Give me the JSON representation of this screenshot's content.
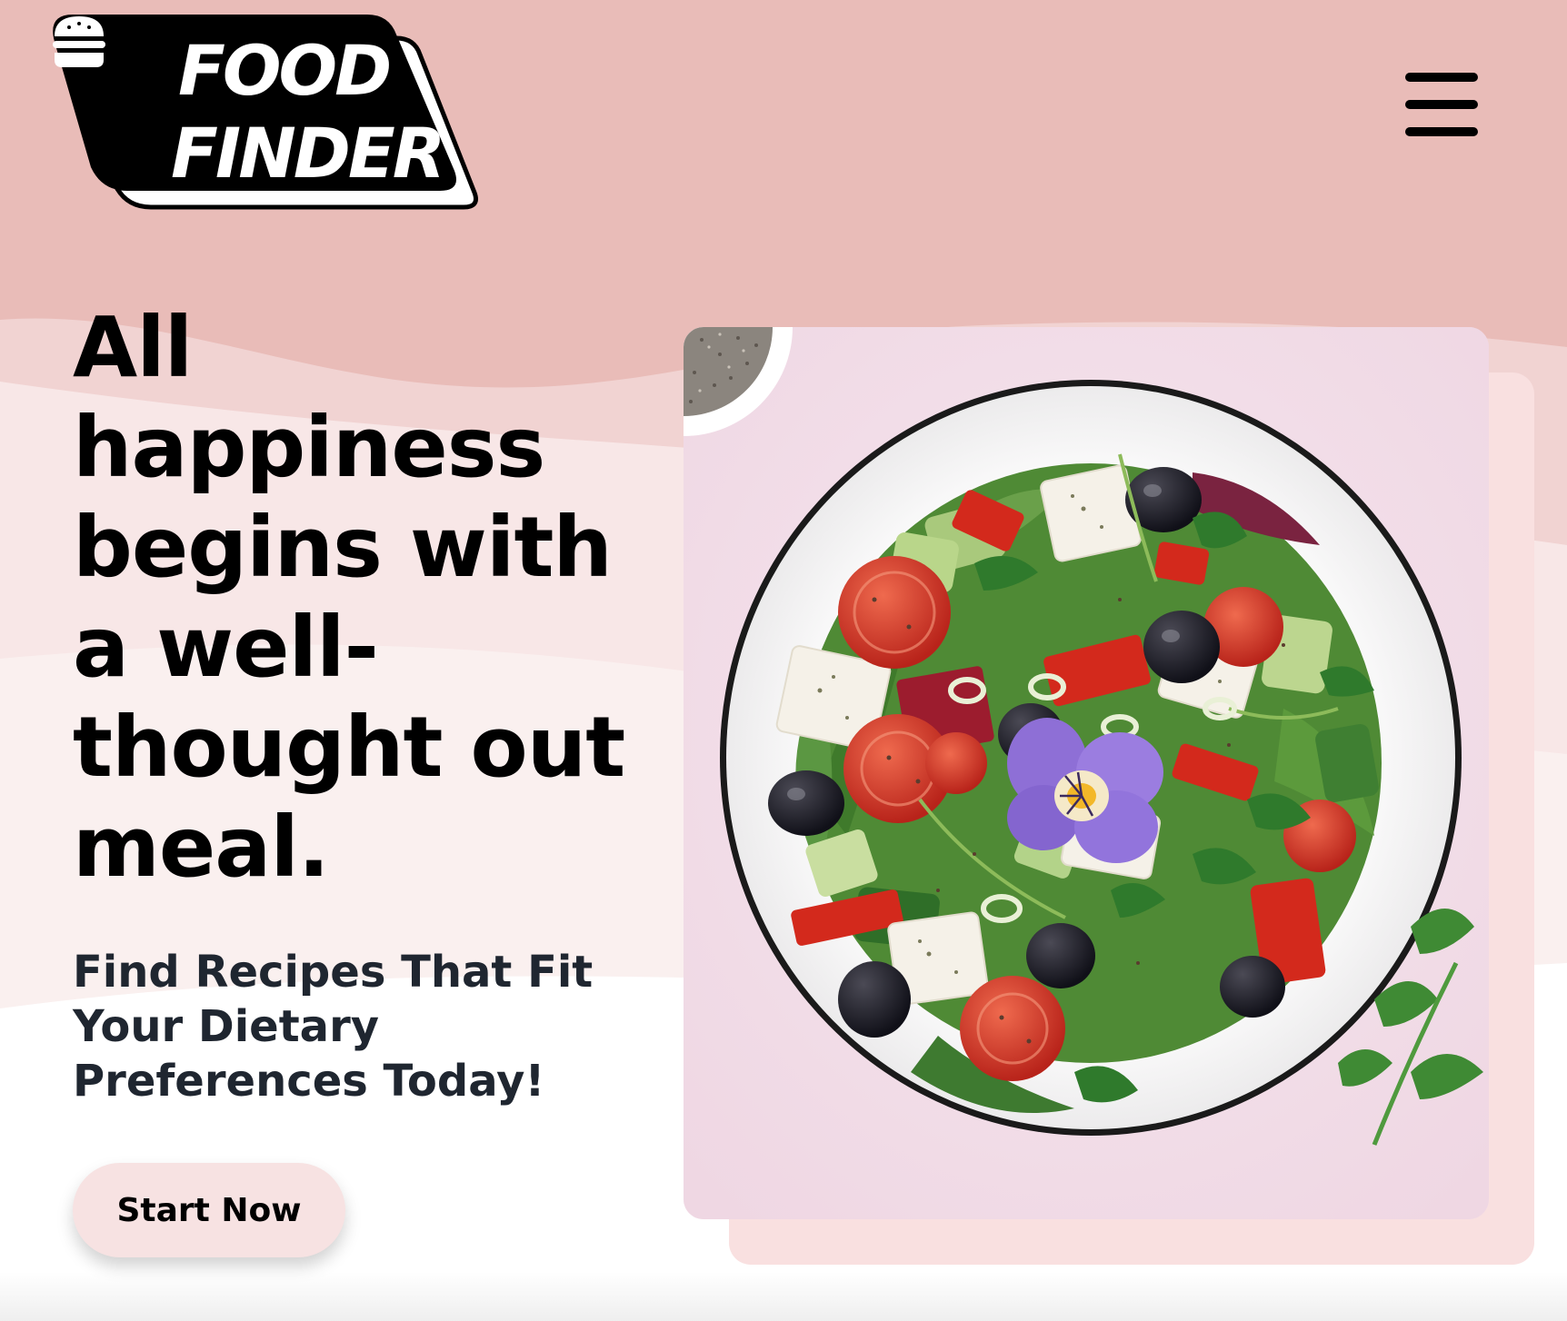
{
  "header": {
    "logo": {
      "line1": "FOOD",
      "line2": "FINDER",
      "icon": "burger-icon"
    },
    "menu_icon": "hamburger-menu-icon"
  },
  "hero": {
    "title_lines": [
      "All",
      "happiness",
      "begins with",
      "a well-",
      "thought out",
      "meal."
    ],
    "subtitle_lines": [
      "Find Recipes That Fit",
      "Your Dietary",
      "Preferences Today!"
    ],
    "cta_label": "Start Now"
  },
  "image": {
    "alt": "salad-bowl-image"
  },
  "colors": {
    "band_top": "#e9bcb8",
    "band_middle": "#f1d2d1",
    "band_light": "#f8e9e8",
    "button_bg": "#f7e2e2",
    "card_bg": "#f3dfe9",
    "card_shadow": "#f9e0e0"
  }
}
